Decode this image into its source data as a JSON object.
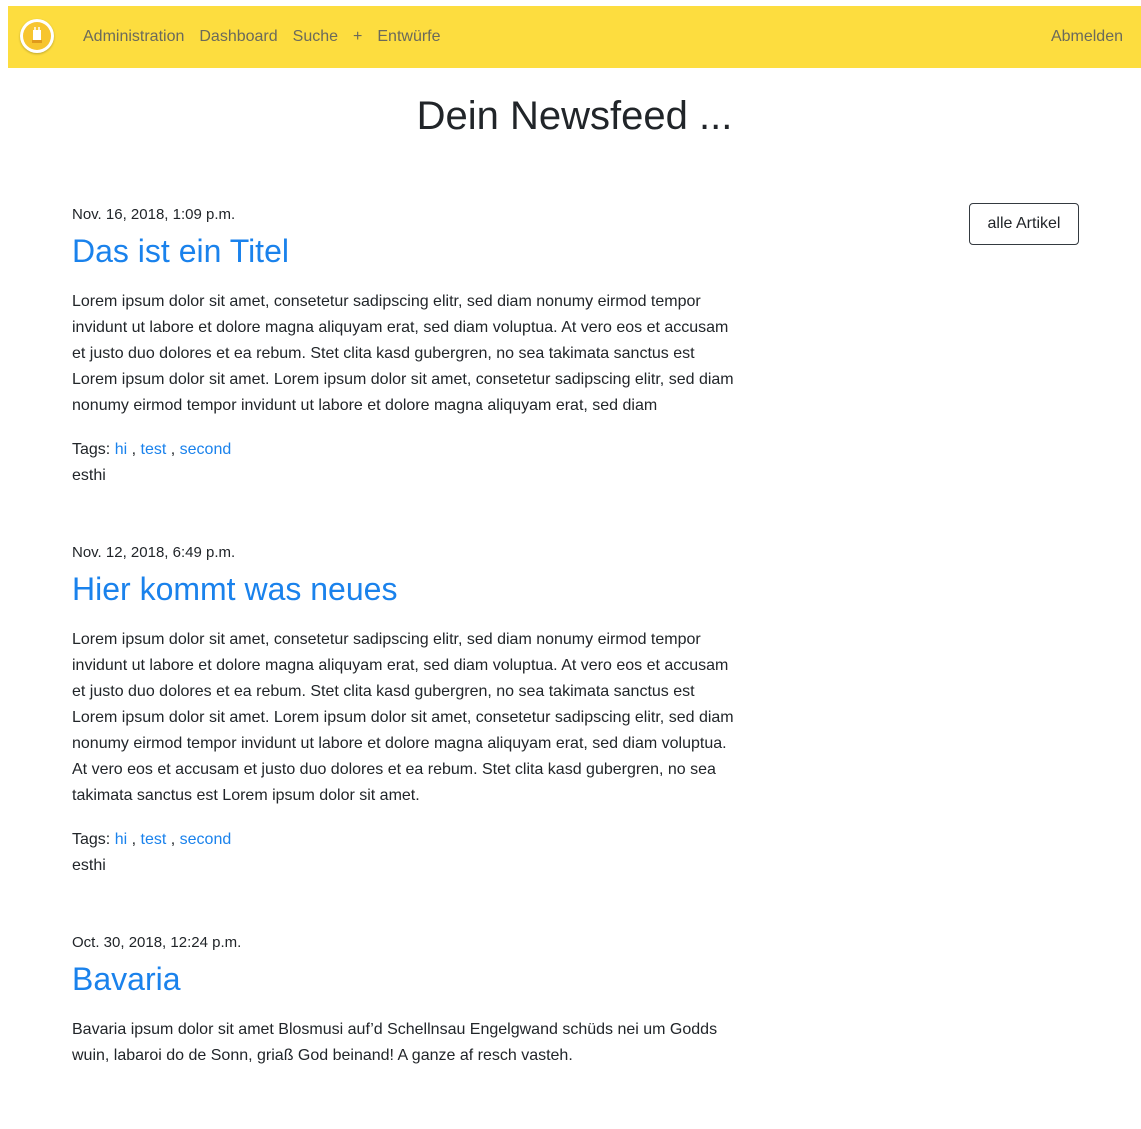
{
  "nav": {
    "links": [
      "Administration",
      "Dashboard",
      "Suche",
      "+",
      "Entwürfe"
    ],
    "logout": "Abmelden"
  },
  "page": {
    "title": "Dein Newsfeed ..."
  },
  "sidebar": {
    "all_articles_label": "alle Artikel"
  },
  "articles": [
    {
      "date": "Nov. 16, 2018, 1:09 p.m.",
      "title": "Das ist ein Titel",
      "body": "Lorem ipsum dolor sit amet, consetetur sadipscing elitr, sed diam nonumy eirmod tempor invidunt ut labore et dolore magna aliquyam erat, sed diam voluptua. At vero eos et accusam et justo duo dolores et ea rebum. Stet clita kasd gubergren, no sea takimata sanctus est Lorem ipsum dolor sit amet. Lorem ipsum dolor sit amet, consetetur sadipscing elitr, sed diam nonumy eirmod tempor invidunt ut labore et dolore magna aliquyam erat, sed diam",
      "tags_label": "Tags:",
      "tags": [
        "hi",
        "test",
        "second"
      ],
      "author": "esthi"
    },
    {
      "date": "Nov. 12, 2018, 6:49 p.m.",
      "title": "Hier kommt was neues",
      "body": "Lorem ipsum dolor sit amet, consetetur sadipscing elitr, sed diam nonumy eirmod tempor invidunt ut labore et dolore magna aliquyam erat, sed diam voluptua. At vero eos et accusam et justo duo dolores et ea rebum. Stet clita kasd gubergren, no sea takimata sanctus est Lorem ipsum dolor sit amet. Lorem ipsum dolor sit amet, consetetur sadipscing elitr, sed diam nonumy eirmod tempor invidunt ut labore et dolore magna aliquyam erat, sed diam voluptua. At vero eos et accusam et justo duo dolores et ea rebum. Stet clita kasd gubergren, no sea takimata sanctus est Lorem ipsum dolor sit amet.",
      "tags_label": "Tags:",
      "tags": [
        "hi",
        "test",
        "second"
      ],
      "author": "esthi"
    },
    {
      "date": "Oct. 30, 2018, 12:24 p.m.",
      "title": "Bavaria",
      "body": "Bavaria ipsum dolor sit amet Blosmusi auf’d Schellnsau Engelgwand schüds nei um Godds wuin, labaroi do de Sonn, griaß God beinand! A ganze af resch vasteh."
    }
  ],
  "colors": {
    "navbar": "#fddd3f",
    "link": "#1a82ec",
    "nav_text": "#6b6a5b"
  }
}
